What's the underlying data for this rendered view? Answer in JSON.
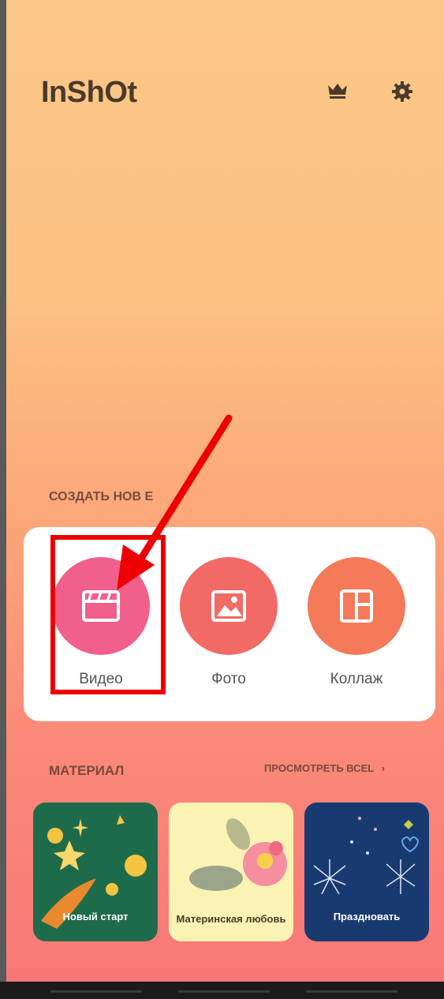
{
  "app": {
    "logo_text": "InShOt"
  },
  "header": {
    "icons": [
      "crown-icon",
      "gear-icon"
    ]
  },
  "create": {
    "title": "СОЗДАТЬ НОВ Е",
    "tiles": [
      {
        "label": "Видео",
        "icon": "clapperboard-icon",
        "color": "#f0608a"
      },
      {
        "label": "Фото",
        "icon": "image-icon",
        "color": "#f26a66"
      },
      {
        "label": "Коллаж",
        "icon": "collage-icon",
        "color": "#f47a5a"
      }
    ]
  },
  "material": {
    "title": "МАТЕРИАЛ",
    "view_all": "ПРОСМОТРЕТЬ ВСЕL",
    "items": [
      {
        "label": "Новый старт",
        "color": "#1e6b4c"
      },
      {
        "label": "Материнская любовь",
        "color": "#fbf3b4"
      },
      {
        "label": "Праздновать",
        "color": "#183a70"
      }
    ]
  },
  "colors": {
    "annotation_red": "#ee0000",
    "accent_text": "#7a4a3c"
  }
}
